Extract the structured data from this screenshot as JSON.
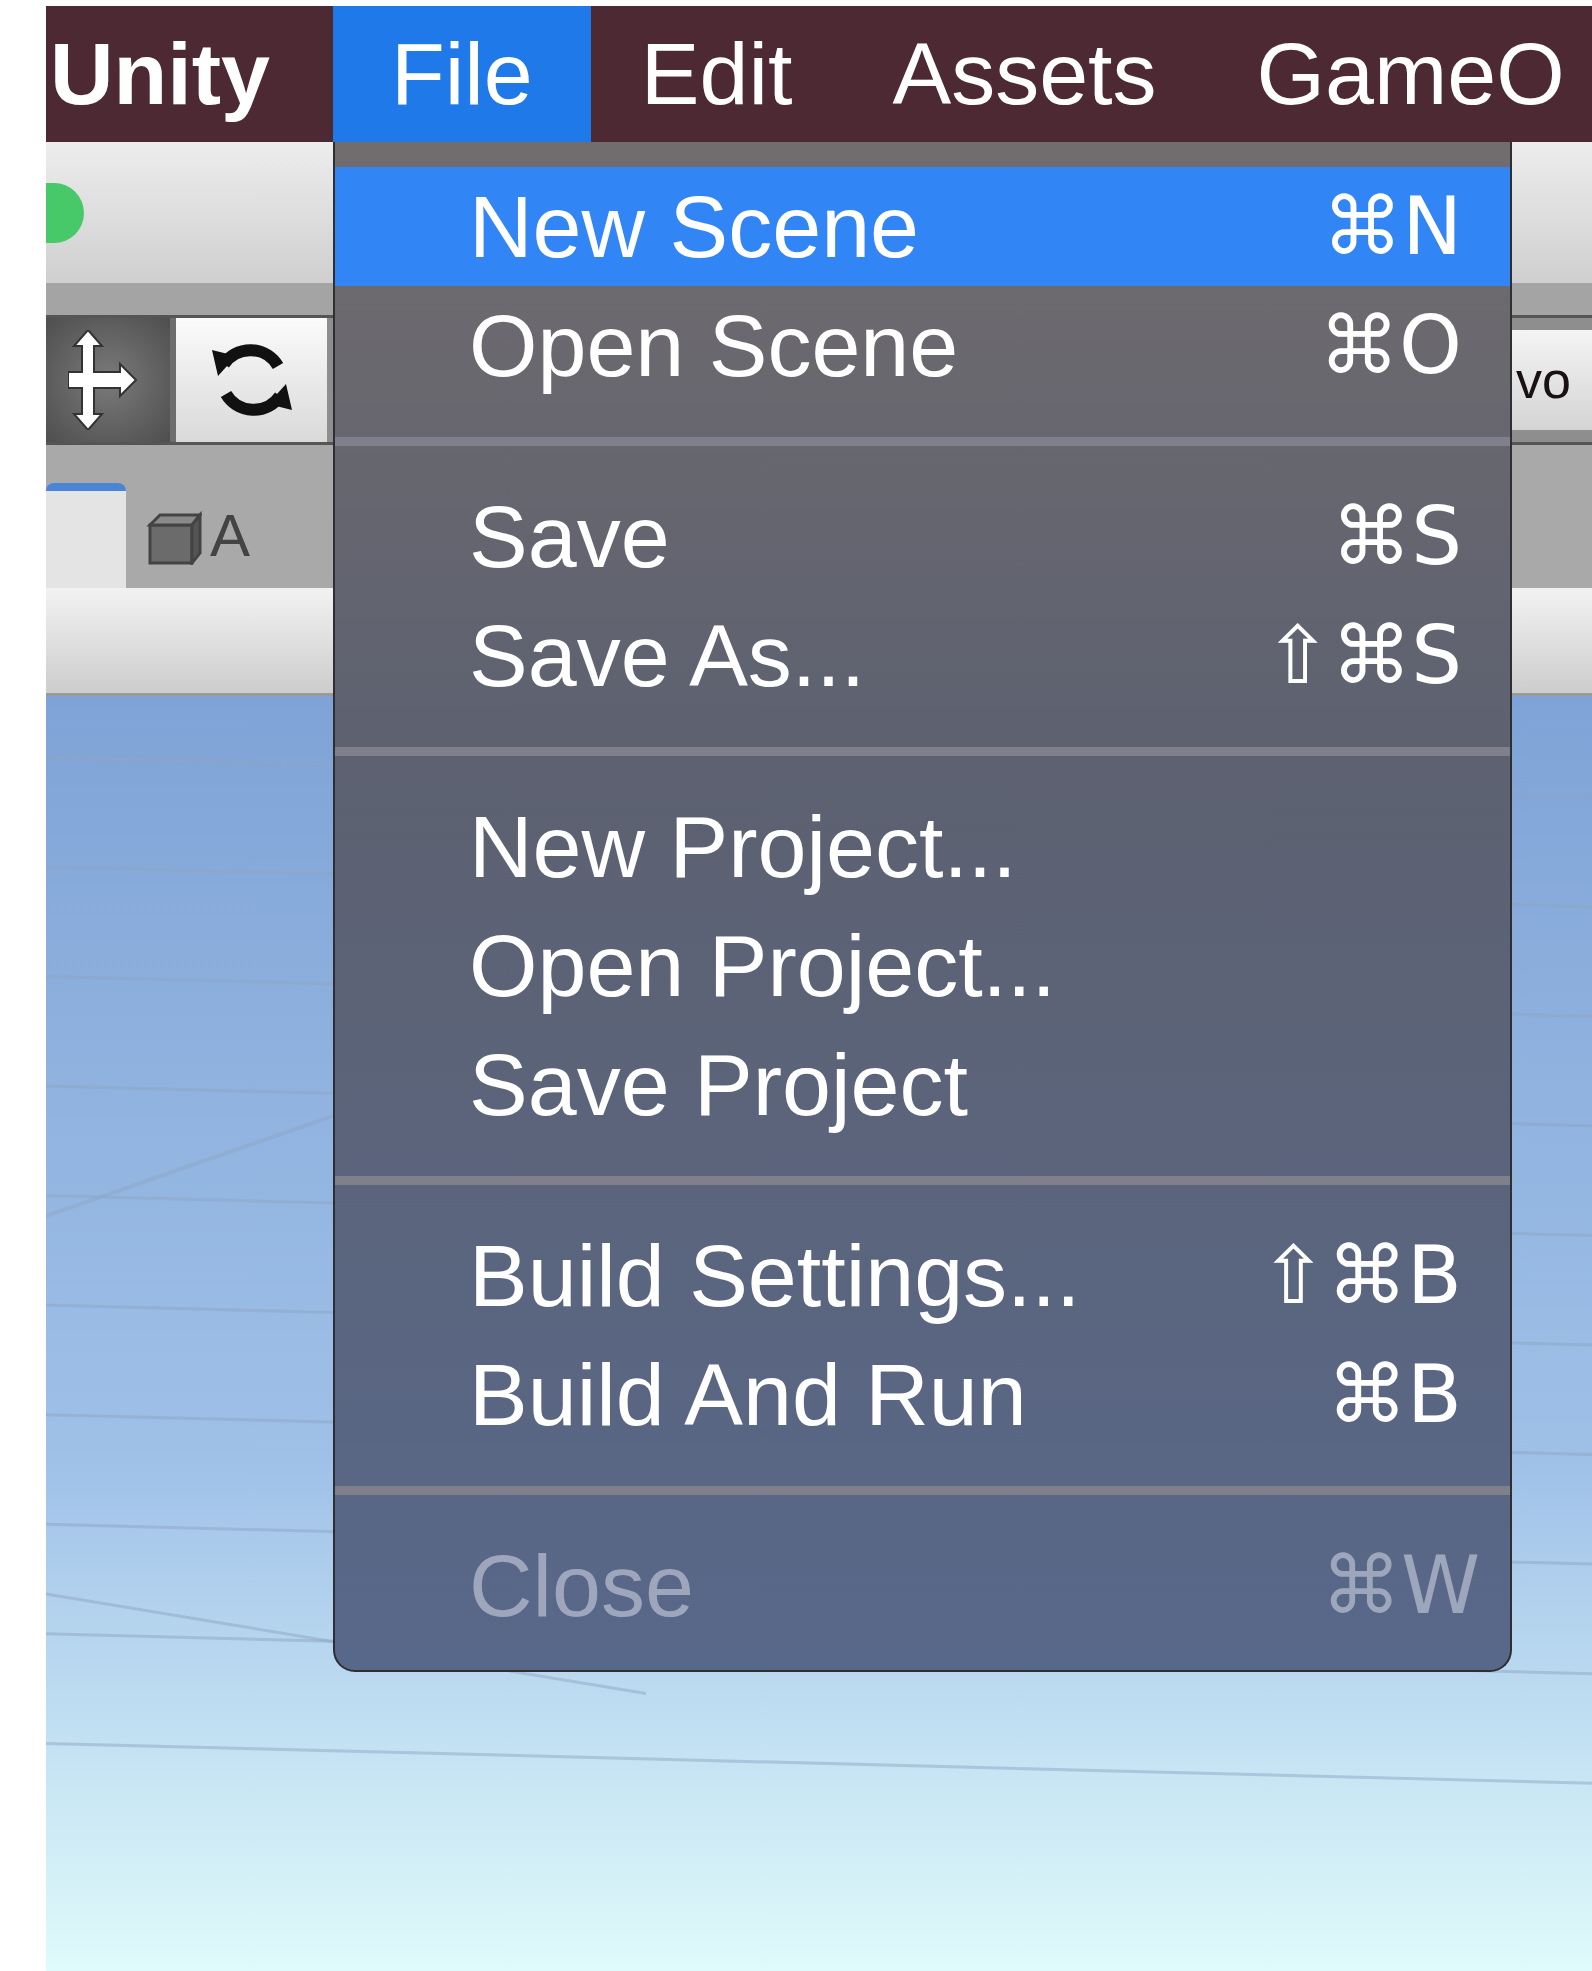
{
  "menu_bar": {
    "app_name": "Unity",
    "menus": [
      {
        "label": "File",
        "selected": true
      },
      {
        "label": "Edit",
        "selected": false
      },
      {
        "label": "Assets",
        "selected": false
      },
      {
        "label": "GameO",
        "selected": false
      }
    ]
  },
  "toolbar": {
    "right_button": "vo"
  },
  "tabs": [
    {
      "selected": true
    },
    {
      "label": "A",
      "selected": false
    }
  ],
  "file_menu": {
    "items": [
      {
        "kind": "item",
        "label": "New Scene",
        "shortcut": "⌘N",
        "selected": true,
        "disabled": false
      },
      {
        "kind": "item",
        "label": "Open Scene",
        "shortcut": "⌘O",
        "selected": false,
        "disabled": false
      },
      {
        "kind": "separator"
      },
      {
        "kind": "item",
        "label": "Save",
        "shortcut": "⌘S",
        "selected": false,
        "disabled": false
      },
      {
        "kind": "item",
        "label": "Save As...",
        "shortcut": "⇧⌘S",
        "selected": false,
        "disabled": false
      },
      {
        "kind": "separator"
      },
      {
        "kind": "item",
        "label": "New Project...",
        "selected": false,
        "disabled": false
      },
      {
        "kind": "item",
        "label": "Open Project...",
        "selected": false,
        "disabled": false
      },
      {
        "kind": "item",
        "label": "Save Project",
        "selected": false,
        "disabled": false
      },
      {
        "kind": "separator"
      },
      {
        "kind": "item",
        "label": "Build Settings...",
        "shortcut": "⇧⌘B",
        "selected": false,
        "disabled": false
      },
      {
        "kind": "item",
        "label": "Build And Run",
        "shortcut": "⌘B",
        "selected": false,
        "disabled": false
      },
      {
        "kind": "separator"
      },
      {
        "kind": "item",
        "label": "Close",
        "shortcut": "⌘W",
        "selected": false,
        "disabled": true
      }
    ]
  }
}
